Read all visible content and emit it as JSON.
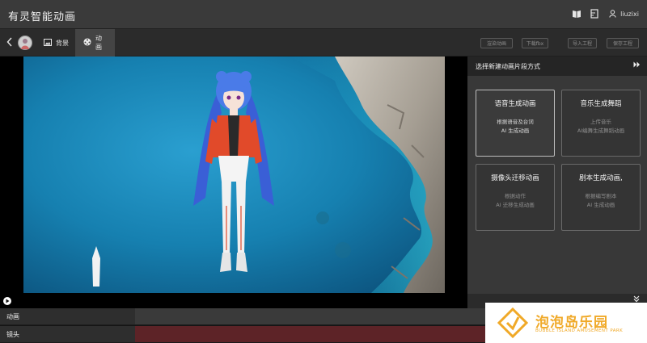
{
  "app": {
    "title": "有灵智能动画"
  },
  "header": {
    "user_name": "liuzixi",
    "icons": [
      "book-icon",
      "ruler-icon",
      "user-icon"
    ]
  },
  "toolbar": {
    "back_icon": "chevron-left-icon",
    "tabs": [
      {
        "label": "背景",
        "icon": "image-icon"
      },
      {
        "label": "动画",
        "icon": "film-reel-icon"
      }
    ],
    "buttons": {
      "render": "渲染动画",
      "download": "下载fbx",
      "import": "导入工程",
      "save": "保存工程"
    }
  },
  "panel": {
    "title": "选择新建动画片段方式",
    "collapse_icon": "double-chevron-right-icon",
    "cards": [
      {
        "title": "语音生成动画",
        "desc1": "根据语音及台词",
        "desc2": "AI 生成动画",
        "active": true
      },
      {
        "title": "音乐生成舞蹈",
        "desc1": "上传音乐",
        "desc2": "AI编舞生成舞蹈动画",
        "active": false
      },
      {
        "title": "摄像头迁移动画",
        "desc1": "根据动作",
        "desc2": "AI 迁移生成动画",
        "active": false
      },
      {
        "title": "剧本生成动画,",
        "desc1": "根据编写剧本",
        "desc2": "AI 生成动画",
        "active": false
      }
    ],
    "footer_icon": "expand-down-icon"
  },
  "timeline": {
    "tracks": [
      {
        "label": "动画"
      },
      {
        "label": "镜头"
      }
    ]
  },
  "watermark": {
    "title": "泡泡岛乐园",
    "subtitle": "BUBBLE ISLAND AMUSEMENT PARK"
  },
  "colors": {
    "sea": "#1e86b4",
    "camera_lane": "#5d2327",
    "watermark_orange": "#f0a928"
  }
}
